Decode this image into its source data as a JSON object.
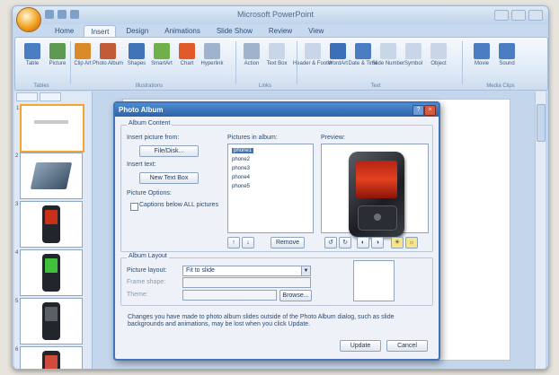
{
  "app": {
    "title": "Microsoft PowerPoint"
  },
  "ribbon": {
    "tabs": [
      "Home",
      "Insert",
      "Design",
      "Animations",
      "Slide Show",
      "Review",
      "View"
    ],
    "active_tab": 1,
    "buttons": [
      {
        "label": "Table",
        "color": "#4a7dc1"
      },
      {
        "label": "Picture",
        "color": "#5e9b52"
      },
      {
        "label": "Clip Art",
        "color": "#d98a2b"
      },
      {
        "label": "Photo Album",
        "color": "#c25b38"
      },
      {
        "label": "Shapes",
        "color": "#3f74b8"
      },
      {
        "label": "SmartArt",
        "color": "#6fb04a"
      },
      {
        "label": "Chart",
        "color": "#e05a2a"
      },
      {
        "label": "Hyperlink",
        "color": "#9fb3cc"
      },
      {
        "label": "Action",
        "color": "#9fb3cc"
      },
      {
        "label": "Text Box",
        "color": "#c8d6e8"
      },
      {
        "label": "Header & Footer",
        "color": "#c8d6e8"
      },
      {
        "label": "WordArt",
        "color": "#3b6fb8"
      },
      {
        "label": "Date & Time",
        "color": "#4a7dc1"
      },
      {
        "label": "Slide Number",
        "color": "#c8d6e8"
      },
      {
        "label": "Symbol",
        "color": "#c8d6e8"
      },
      {
        "label": "Object",
        "color": "#c8d6e8"
      },
      {
        "label": "Movie",
        "color": "#4a7dc1"
      },
      {
        "label": "Sound",
        "color": "#4a7dc1"
      }
    ],
    "groups": [
      "Tables",
      "Illustrations",
      "Links",
      "Text",
      "Media Clips"
    ]
  },
  "slides": [
    {
      "num": "1",
      "kind": "title"
    },
    {
      "num": "2",
      "kind": "laptop"
    },
    {
      "num": "3",
      "kind": "phone-red"
    },
    {
      "num": "4",
      "kind": "phone-green"
    },
    {
      "num": "5",
      "kind": "phone-dark"
    },
    {
      "num": "6",
      "kind": "phones"
    }
  ],
  "dialog": {
    "title": "Photo Album",
    "help_glyph": "?",
    "close_glyph": "×",
    "album_content_label": "Album Content",
    "insert_from_label": "Insert picture from:",
    "file_disk_button": "File/Disk...",
    "insert_text_label": "Insert text:",
    "new_text_box_button": "New Text Box",
    "picture_options_label": "Picture Options:",
    "captions_below_label": "Captions below ALL pictures",
    "pictures_in_album_label": "Pictures in album:",
    "pictures": [
      "phone1",
      "phone2",
      "phone3",
      "phone4",
      "phone5"
    ],
    "selected_picture": 0,
    "preview_label": "Preview:",
    "remove_button": "Remove",
    "album_layout_label": "Album Layout",
    "picture_layout_label": "Picture layout:",
    "picture_layout_value": "Fit to slide",
    "frame_shape_label": "Frame shape:",
    "theme_label": "Theme:",
    "browse_button": "Browse...",
    "note": "Changes you have made to photo album slides outside of the Photo Album dialog, such as slide backgrounds and animations, may be lost when you click Update.",
    "update_button": "Update",
    "cancel_button": "Cancel"
  }
}
